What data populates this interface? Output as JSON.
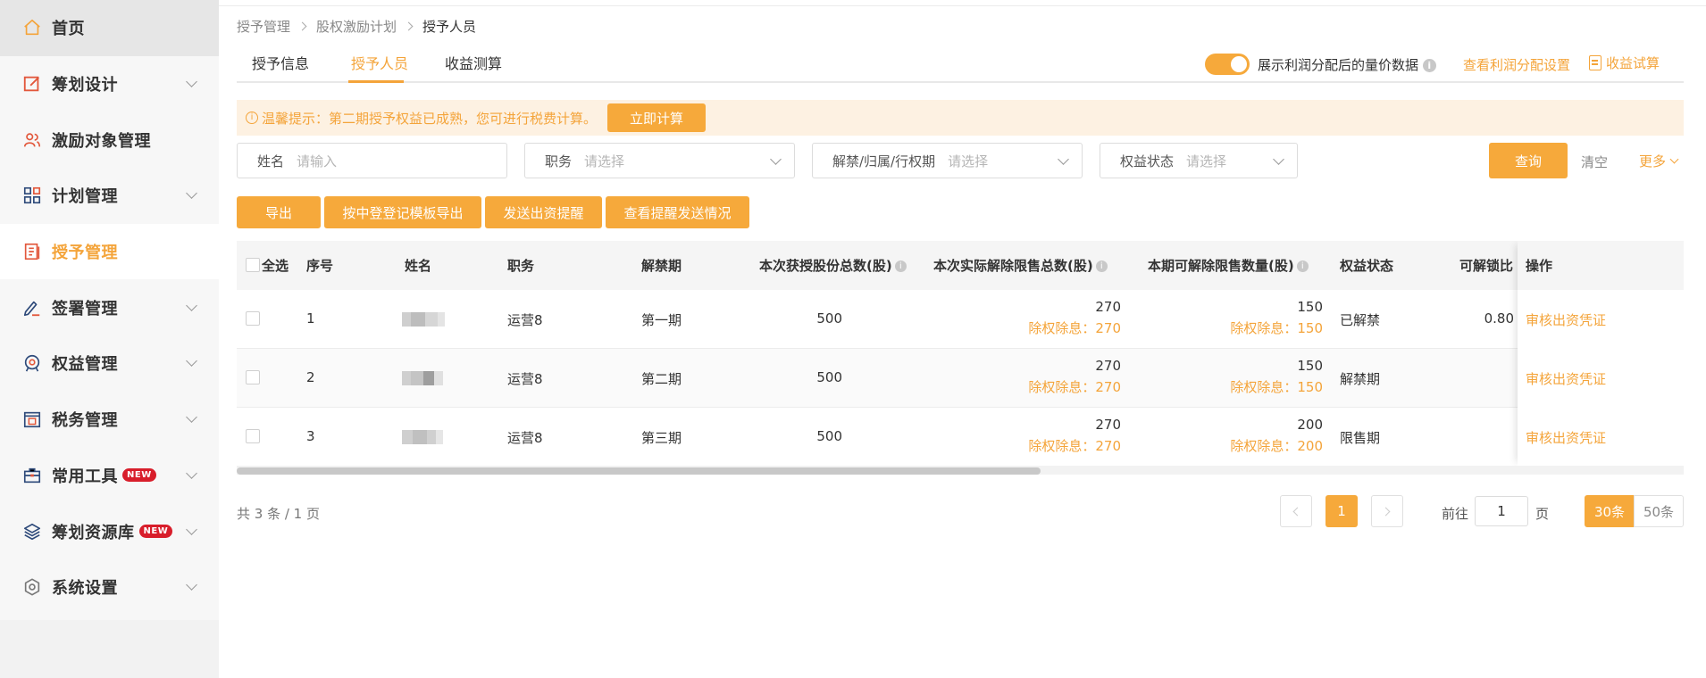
{
  "sidebar": {
    "items": [
      {
        "label": "首页",
        "icon": "home-icon"
      },
      {
        "label": "筹划设计",
        "icon": "edit-square-icon"
      },
      {
        "label": "激励对象管理",
        "icon": "users-icon"
      },
      {
        "label": "计划管理",
        "icon": "grid-icon"
      },
      {
        "label": "授予管理",
        "icon": "list-book-icon"
      },
      {
        "label": "签署管理",
        "icon": "signature-icon"
      },
      {
        "label": "权益管理",
        "icon": "badge-icon"
      },
      {
        "label": "税务管理",
        "icon": "tax-icon"
      },
      {
        "label": "常用工具",
        "icon": "toolbox-icon",
        "badge": "NEW"
      },
      {
        "label": "筹划资源库",
        "icon": "layers-icon",
        "badge": "NEW"
      },
      {
        "label": "系统设置",
        "icon": "gear-icon"
      }
    ],
    "active_index": 4
  },
  "breadcrumb": [
    "授予管理",
    "股权激励计划",
    "授予人员"
  ],
  "tabs": [
    "授予信息",
    "授予人员",
    "收益测算"
  ],
  "active_tab": 1,
  "toggle": {
    "label": "展示利润分配后的量价数据",
    "on": true
  },
  "links": {
    "profit_settings": "查看利润分配设置",
    "calc": "收益试算"
  },
  "notice": {
    "text": "温馨提示：第二期授予权益已成熟，您可进行税费计算。",
    "button": "立即计算"
  },
  "filters": {
    "name": {
      "label": "姓名",
      "placeholder": "请输入"
    },
    "position": {
      "label": "职务",
      "placeholder": "请选择"
    },
    "period": {
      "label": "解禁/归属/行权期",
      "placeholder": "请选择"
    },
    "status": {
      "label": "权益状态",
      "placeholder": "请选择"
    },
    "query": "查询",
    "clear": "清空",
    "more": "更多"
  },
  "actions": [
    "导出",
    "按中登登记模板导出",
    "发送出资提醒",
    "查看提醒发送情况"
  ],
  "table": {
    "headers": {
      "select_all": "全选",
      "index": "序号",
      "name": "姓名",
      "position": "职务",
      "period": "解禁期",
      "granted": "本次获授股份总数(股)",
      "released": "本次实际解除限售总数(股)",
      "releasable": "本期可解除限售数量(股)",
      "status": "权益状态",
      "ratio": "可解锁比",
      "op": "操作"
    },
    "sub_prefix": "除权除息：",
    "rows": [
      {
        "index": "1",
        "position": "运营8",
        "period": "第一期",
        "granted": "500",
        "released": "270",
        "released_adj": "除权除息：270",
        "releasable": "150",
        "releasable_adj": "除权除息：150",
        "status": "已解禁",
        "ratio": "0.80",
        "op": "审核出资凭证"
      },
      {
        "index": "2",
        "position": "运营8",
        "period": "第二期",
        "granted": "500",
        "released": "270",
        "released_adj": "除权除息：270",
        "releasable": "150",
        "releasable_adj": "除权除息：150",
        "status": "解禁期",
        "ratio": "",
        "op": "审核出资凭证"
      },
      {
        "index": "3",
        "position": "运营8",
        "period": "第三期",
        "granted": "500",
        "released": "270",
        "released_adj": "除权除息：270",
        "releasable": "200",
        "releasable_adj": "除权除息：200",
        "status": "限售期",
        "ratio": "",
        "op": "审核出资凭证"
      }
    ]
  },
  "pagination": {
    "total": "共 3 条 / 1 页",
    "current": "1",
    "goto_label": "前往",
    "goto_value": "1",
    "page_unit": "页",
    "sizes": [
      "30条",
      "50条"
    ]
  },
  "colors": {
    "accent": "#f6a93b",
    "accent_text": "#f4a43a",
    "notice_bg": "#fdf1e2",
    "new_badge": "#d81e2b"
  }
}
